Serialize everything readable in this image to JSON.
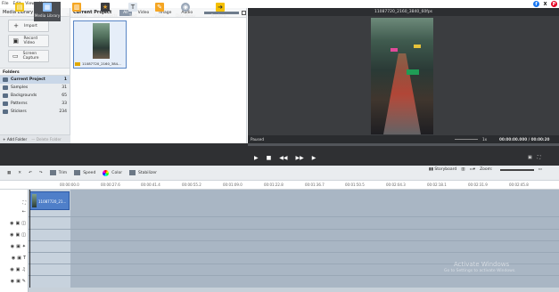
{
  "menu": [
    "File",
    "Edit",
    "View",
    "Help"
  ],
  "social": {
    "facebook": "f",
    "x": "X",
    "pinterest": "P"
  },
  "media_library": {
    "title": "Media Library",
    "buttons": [
      {
        "label": "Import",
        "icon": "plus-icon"
      },
      {
        "label": "Record Video",
        "icon": "camera-icon"
      },
      {
        "label": "Screen Capture",
        "icon": "monitor-icon"
      }
    ],
    "folders_header": "Folders",
    "folders": [
      {
        "name": "Current Project",
        "count": "1"
      },
      {
        "name": "Samples",
        "count": "31"
      },
      {
        "name": "Backgrounds",
        "count": "65"
      },
      {
        "name": "Patterns",
        "count": "33"
      },
      {
        "name": "Stickers",
        "count": "234"
      }
    ],
    "add_folder": "+ Add Folder",
    "delete_folder": "— Delete Folder"
  },
  "project": {
    "title": "Current Project",
    "tabs": [
      "All",
      "Video",
      "Image",
      "Audio"
    ],
    "active_tab": "All",
    "item_name": "11087720_2160_384..."
  },
  "preview": {
    "title": "11087720_2160_3840_60fps",
    "label": "Paused",
    "speed": "1x",
    "timecode": "00:00:00.000 / 00:00:20"
  },
  "tools": [
    {
      "label": "Projects",
      "icon": "projects-icon",
      "color": "#f0c419"
    },
    {
      "label": "Media Library",
      "icon": "film-icon",
      "color": "#8ec1ff"
    },
    {
      "label": "Transitions",
      "icon": "transition-icon",
      "color": "#f5a623"
    },
    {
      "label": "Video Effects",
      "icon": "star-icon",
      "color": "#e0a030"
    },
    {
      "label": "Text",
      "icon": "text-icon",
      "color": "#dfe6ee"
    },
    {
      "label": "Voice",
      "icon": "pen-icon",
      "color": "#f5a623"
    },
    {
      "label": "Disc Menu",
      "icon": "disc-icon",
      "color": "#9aa7b8"
    },
    {
      "label": "Produce...",
      "icon": "produce-icon",
      "color": "#f5c000"
    }
  ],
  "timeline_tools": {
    "trim": "Trim",
    "speed": "Speed",
    "color": "Color",
    "stabilizer": "Stabilizer",
    "mode": "Storyboard",
    "zoom_label": "Zoom:"
  },
  "ruler_ticks": [
    "00:00:00.0",
    "00:00:27.6",
    "00:00:41.4",
    "00:00:55.2",
    "00:01:09.0",
    "00:01:22.8",
    "00:01:36.7",
    "00:01:50.5",
    "00:02:04.3",
    "00:02:18.1",
    "00:02:31.9",
    "00:02:45.8",
    "00:02:59.6"
  ],
  "clip_name": "11087720_21...",
  "watermark": {
    "line1": "Activate Windows",
    "line2": "Go to Settings to activate Windows."
  }
}
